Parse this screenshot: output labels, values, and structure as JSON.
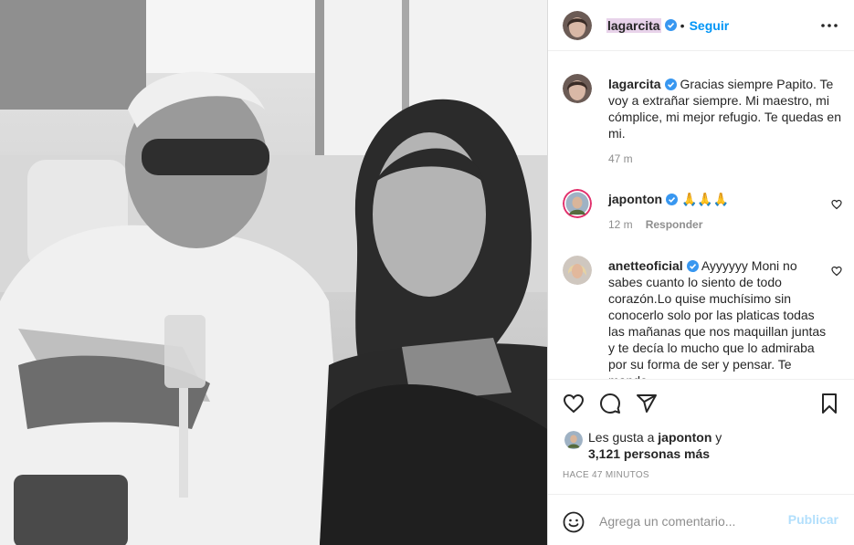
{
  "post": {
    "image_icon": "photo-black-white-man-and-woman"
  },
  "header": {
    "username": "lagarcita",
    "follow_label": "Seguir",
    "more_icon": "more-horizontal-icon"
  },
  "comments": [
    {
      "username": "lagarcita",
      "text": "Gracias siempre Papito. Te voy a extrañar siempre. Mi maestro, mi cómplice, mi mejor refugio. Te quedas en mi.",
      "time": "47 m",
      "reply": ""
    },
    {
      "username": "japonton",
      "text": "🙏🙏🙏",
      "time": "12 m",
      "reply": "Responder"
    },
    {
      "username": "anetteoficial",
      "text": "Ayyyyyy Moni no sabes cuanto lo siento de todo corazón.Lo quise muchísimo sin conocerlo solo por las platicas todas las mañanas que nos maquillan juntas y te decía lo mucho que lo admiraba por su forma de ser y pensar. Te mando",
      "time": "",
      "reply": ""
    }
  ],
  "likes": {
    "prefix": "Les gusta a",
    "user": "japonton",
    "joiner": "y",
    "count_text": "3,121 personas más"
  },
  "timestamp": "HACE 47 MINUTOS",
  "add_comment": {
    "placeholder": "Agrega un comentario...",
    "post_label": "Publicar"
  },
  "colors": {
    "accent": "#0095f6",
    "verified": "#3897f0",
    "muted": "#8e8e8e",
    "publish_disabled": "#b2dffc"
  }
}
